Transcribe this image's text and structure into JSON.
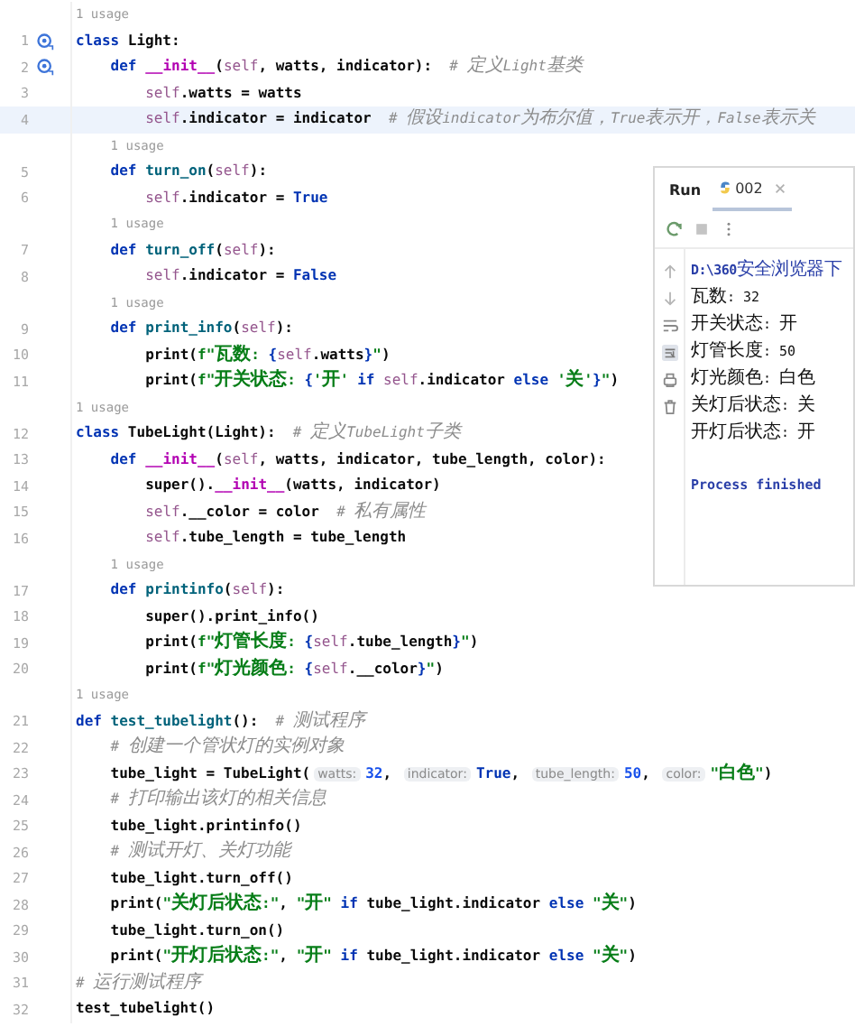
{
  "editor": {
    "lines": [
      {
        "usage": "1 usage",
        "number": "1",
        "highlighted": false,
        "gutter_mark": true,
        "tokens": [
          {
            "kind": "keyword",
            "text": "class"
          },
          {
            "kind": "plain",
            "text": " Light:"
          }
        ],
        "children": [
          {
            "number": "2",
            "highlighted": false,
            "gutter_mark": true,
            "tokens": [
              {
                "kind": "keyword",
                "text": "def"
              },
              {
                "kind": "magic",
                "text": " __init__"
              },
              {
                "kind": "plain",
                "text": "("
              },
              {
                "kind": "self",
                "text": "self"
              },
              {
                "kind": "plain",
                "text": ", watts, indicator):  "
              },
              {
                "kind": "comment",
                "text": "# 定义Light基类"
              }
            ],
            "children": [
              {
                "number": "3",
                "highlighted": false,
                "gutter_mark": false,
                "tokens": [
                  {
                    "kind": "self",
                    "text": "self"
                  },
                  {
                    "kind": "plain",
                    "text": ".watts = watts"
                  }
                ]
              },
              {
                "number": "4",
                "highlighted": true,
                "gutter_mark": false,
                "tokens": [
                  {
                    "kind": "self",
                    "text": "self"
                  },
                  {
                    "kind": "plain",
                    "text": ".indicator = indicator  "
                  },
                  {
                    "kind": "comment",
                    "text": "# 假设indicator为布尔值，True表示开，False表示关"
                  }
                ]
              }
            ]
          },
          {
            "usage": "1 usage",
            "number": "5",
            "highlighted": false,
            "gutter_mark": false,
            "tokens": [
              {
                "kind": "keyword",
                "text": "def"
              },
              {
                "kind": "name",
                "text": " turn_on"
              },
              {
                "kind": "plain",
                "text": "("
              },
              {
                "kind": "self",
                "text": "self"
              },
              {
                "kind": "plain",
                "text": "):"
              }
            ],
            "children": [
              {
                "number": "6",
                "highlighted": false,
                "gutter_mark": false,
                "tokens": [
                  {
                    "kind": "self",
                    "text": "self"
                  },
                  {
                    "kind": "plain",
                    "text": ".indicator = "
                  },
                  {
                    "kind": "keyword",
                    "text": "True"
                  }
                ]
              }
            ]
          },
          {
            "usage": "1 usage",
            "number": "7",
            "highlighted": false,
            "gutter_mark": false,
            "tokens": [
              {
                "kind": "keyword",
                "text": "def"
              },
              {
                "kind": "name",
                "text": " turn_off"
              },
              {
                "kind": "plain",
                "text": "("
              },
              {
                "kind": "self",
                "text": "self"
              },
              {
                "kind": "plain",
                "text": "):"
              }
            ],
            "children": [
              {
                "number": "8",
                "highlighted": false,
                "gutter_mark": false,
                "tokens": [
                  {
                    "kind": "self",
                    "text": "self"
                  },
                  {
                    "kind": "plain",
                    "text": ".indicator = "
                  },
                  {
                    "kind": "keyword",
                    "text": "False"
                  }
                ]
              }
            ]
          },
          {
            "usage": "1 usage",
            "number": "9",
            "highlighted": false,
            "gutter_mark": false,
            "tokens": [
              {
                "kind": "keyword",
                "text": "def"
              },
              {
                "kind": "name",
                "text": " print_info"
              },
              {
                "kind": "plain",
                "text": "("
              },
              {
                "kind": "self",
                "text": "self"
              },
              {
                "kind": "plain",
                "text": "):"
              }
            ],
            "children": [
              {
                "number": "10",
                "highlighted": false,
                "gutter_mark": false,
                "tokens": [
                  {
                    "kind": "plain",
                    "text": "print("
                  },
                  {
                    "kind": "string",
                    "text": "f\"瓦数: "
                  },
                  {
                    "kind": "keyword",
                    "text": "{"
                  },
                  {
                    "kind": "self",
                    "text": "self"
                  },
                  {
                    "kind": "plain",
                    "text": ".watts"
                  },
                  {
                    "kind": "keyword",
                    "text": "}"
                  },
                  {
                    "kind": "string",
                    "text": "\""
                  },
                  {
                    "kind": "plain",
                    "text": ")"
                  }
                ]
              },
              {
                "number": "11",
                "highlighted": false,
                "gutter_mark": false,
                "tokens": [
                  {
                    "kind": "plain",
                    "text": "print("
                  },
                  {
                    "kind": "string",
                    "text": "f\"开关状态: "
                  },
                  {
                    "kind": "keyword",
                    "text": "{"
                  },
                  {
                    "kind": "string",
                    "text": "'开' "
                  },
                  {
                    "kind": "keyword",
                    "text": "if "
                  },
                  {
                    "kind": "self",
                    "text": "self"
                  },
                  {
                    "kind": "plain",
                    "text": ".indicator "
                  },
                  {
                    "kind": "keyword",
                    "text": "else "
                  },
                  {
                    "kind": "string",
                    "text": "'关'"
                  },
                  {
                    "kind": "keyword",
                    "text": "}"
                  },
                  {
                    "kind": "string",
                    "text": "\""
                  },
                  {
                    "kind": "plain",
                    "text": ")"
                  }
                ]
              }
            ]
          }
        ]
      },
      {
        "usage": "1 usage",
        "number": "12",
        "highlighted": false,
        "gutter_mark": false,
        "tokens": [
          {
            "kind": "keyword",
            "text": "class"
          },
          {
            "kind": "plain",
            "text": " TubeLight(Light):  "
          },
          {
            "kind": "comment",
            "text": "# 定义TubeLight子类"
          }
        ],
        "children": [
          {
            "number": "13",
            "highlighted": false,
            "gutter_mark": false,
            "tokens": [
              {
                "kind": "keyword",
                "text": "def"
              },
              {
                "kind": "magic",
                "text": " __init__"
              },
              {
                "kind": "plain",
                "text": "("
              },
              {
                "kind": "self",
                "text": "self"
              },
              {
                "kind": "plain",
                "text": ", watts, indicator, tube_length, color):"
              }
            ],
            "children": [
              {
                "number": "14",
                "highlighted": false,
                "gutter_mark": false,
                "tokens": [
                  {
                    "kind": "plain",
                    "text": "super()."
                  },
                  {
                    "kind": "magic",
                    "text": "__init__"
                  },
                  {
                    "kind": "plain",
                    "text": "(watts, indicator)"
                  }
                ]
              },
              {
                "number": "15",
                "highlighted": false,
                "gutter_mark": false,
                "tokens": [
                  {
                    "kind": "self",
                    "text": "self"
                  },
                  {
                    "kind": "plain",
                    "text": ".__color = color  "
                  },
                  {
                    "kind": "comment",
                    "text": "# 私有属性"
                  }
                ]
              },
              {
                "number": "16",
                "highlighted": false,
                "gutter_mark": false,
                "tokens": [
                  {
                    "kind": "self",
                    "text": "self"
                  },
                  {
                    "kind": "plain",
                    "text": ".tube_length = tube_length"
                  }
                ]
              }
            ]
          },
          {
            "usage": "1 usage",
            "number": "17",
            "highlighted": false,
            "gutter_mark": false,
            "tokens": [
              {
                "kind": "keyword",
                "text": "def"
              },
              {
                "kind": "name",
                "text": " printinfo"
              },
              {
                "kind": "plain",
                "text": "("
              },
              {
                "kind": "self",
                "text": "self"
              },
              {
                "kind": "plain",
                "text": "):"
              }
            ],
            "children": [
              {
                "number": "18",
                "highlighted": false,
                "gutter_mark": false,
                "tokens": [
                  {
                    "kind": "plain",
                    "text": "super().print_info()"
                  }
                ]
              },
              {
                "number": "19",
                "highlighted": false,
                "gutter_mark": false,
                "tokens": [
                  {
                    "kind": "plain",
                    "text": "print("
                  },
                  {
                    "kind": "string",
                    "text": "f\"灯管长度: "
                  },
                  {
                    "kind": "keyword",
                    "text": "{"
                  },
                  {
                    "kind": "self",
                    "text": "self"
                  },
                  {
                    "kind": "plain",
                    "text": ".tube_length"
                  },
                  {
                    "kind": "keyword",
                    "text": "}"
                  },
                  {
                    "kind": "string",
                    "text": "\""
                  },
                  {
                    "kind": "plain",
                    "text": ")"
                  }
                ]
              },
              {
                "number": "20",
                "highlighted": false,
                "gutter_mark": false,
                "tokens": [
                  {
                    "kind": "plain",
                    "text": "print("
                  },
                  {
                    "kind": "string",
                    "text": "f\"灯光颜色: "
                  },
                  {
                    "kind": "keyword",
                    "text": "{"
                  },
                  {
                    "kind": "self",
                    "text": "self"
                  },
                  {
                    "kind": "plain",
                    "text": ".__color"
                  },
                  {
                    "kind": "keyword",
                    "text": "}"
                  },
                  {
                    "kind": "string",
                    "text": "\""
                  },
                  {
                    "kind": "plain",
                    "text": ")"
                  }
                ]
              }
            ]
          }
        ]
      },
      {
        "usage": "1 usage",
        "number": "21",
        "highlighted": false,
        "gutter_mark": false,
        "tokens": [
          {
            "kind": "keyword",
            "text": "def"
          },
          {
            "kind": "name",
            "text": " test_tubelight"
          },
          {
            "kind": "plain",
            "text": "():  "
          },
          {
            "kind": "comment",
            "text": "# 测试程序"
          }
        ],
        "children": [
          {
            "number": "22",
            "highlighted": false,
            "gutter_mark": false,
            "tokens": [
              {
                "kind": "comment",
                "text": "# 创建一个管状灯的实例对象"
              }
            ]
          },
          {
            "number": "23",
            "highlighted": false,
            "gutter_mark": false,
            "tokens": [
              {
                "kind": "plain",
                "text": "tube_light = TubeLight("
              },
              {
                "kind": "hint",
                "text": "watts:"
              },
              {
                "kind": "number",
                "text": "32"
              },
              {
                "kind": "plain",
                "text": ", "
              },
              {
                "kind": "hint",
                "text": "indicator:"
              },
              {
                "kind": "keyword",
                "text": "True"
              },
              {
                "kind": "plain",
                "text": ", "
              },
              {
                "kind": "hint",
                "text": "tube_length:"
              },
              {
                "kind": "number",
                "text": "50"
              },
              {
                "kind": "plain",
                "text": ", "
              },
              {
                "kind": "hint",
                "text": "color:"
              },
              {
                "kind": "string",
                "text": "\"白色\""
              },
              {
                "kind": "plain",
                "text": ")"
              }
            ]
          },
          {
            "number": "24",
            "highlighted": false,
            "gutter_mark": false,
            "tokens": [
              {
                "kind": "comment",
                "text": "# 打印输出该灯的相关信息"
              }
            ]
          },
          {
            "number": "25",
            "highlighted": false,
            "gutter_mark": false,
            "tokens": [
              {
                "kind": "plain",
                "text": "tube_light.printinfo()"
              }
            ]
          },
          {
            "number": "26",
            "highlighted": false,
            "gutter_mark": false,
            "tokens": [
              {
                "kind": "comment",
                "text": "# 测试开灯、关灯功能"
              }
            ]
          },
          {
            "number": "27",
            "highlighted": false,
            "gutter_mark": false,
            "tokens": [
              {
                "kind": "plain",
                "text": "tube_light.turn_off()"
              }
            ]
          },
          {
            "number": "28",
            "highlighted": false,
            "gutter_mark": false,
            "tokens": [
              {
                "kind": "plain",
                "text": "print("
              },
              {
                "kind": "string",
                "text": "\"关灯后状态:\""
              },
              {
                "kind": "plain",
                "text": ", "
              },
              {
                "kind": "string",
                "text": "\"开\" "
              },
              {
                "kind": "keyword",
                "text": "if"
              },
              {
                "kind": "plain",
                "text": " tube_light.indicator "
              },
              {
                "kind": "keyword",
                "text": "else"
              },
              {
                "kind": "string",
                "text": " \"关\""
              },
              {
                "kind": "plain",
                "text": ")"
              }
            ]
          },
          {
            "number": "29",
            "highlighted": false,
            "gutter_mark": false,
            "tokens": [
              {
                "kind": "plain",
                "text": "tube_light.turn_on()"
              }
            ]
          },
          {
            "number": "30",
            "highlighted": false,
            "gutter_mark": false,
            "tokens": [
              {
                "kind": "plain",
                "text": "print("
              },
              {
                "kind": "string",
                "text": "\"开灯后状态:\""
              },
              {
                "kind": "plain",
                "text": ", "
              },
              {
                "kind": "string",
                "text": "\"开\" "
              },
              {
                "kind": "keyword",
                "text": "if"
              },
              {
                "kind": "plain",
                "text": " tube_light.indicator "
              },
              {
                "kind": "keyword",
                "text": "else"
              },
              {
                "kind": "string",
                "text": " \"关\""
              },
              {
                "kind": "plain",
                "text": ")"
              }
            ]
          }
        ]
      },
      {
        "number": "31",
        "highlighted": false,
        "gutter_mark": false,
        "tokens": [
          {
            "kind": "comment",
            "text": "# 运行测试程序"
          }
        ]
      },
      {
        "number": "32",
        "highlighted": false,
        "gutter_mark": false,
        "tokens": [
          {
            "kind": "plain",
            "text": "test_tubelight()"
          }
        ]
      }
    ]
  },
  "run_panel": {
    "tabs": [
      {
        "label": "Run",
        "kind": "title",
        "selected": false
      },
      {
        "label": "002",
        "kind": "config",
        "selected": true
      }
    ],
    "output": [
      {
        "kind": "path",
        "text": "D:\\360安全浏览器下"
      },
      {
        "kind": "text",
        "text": "瓦数: 32"
      },
      {
        "kind": "text",
        "text": "开关状态: 开"
      },
      {
        "kind": "text",
        "text": "灯管长度: 50"
      },
      {
        "kind": "text",
        "text": "灯光颜色: 白色"
      },
      {
        "kind": "text",
        "text": "关灯后状态: 关"
      },
      {
        "kind": "text",
        "text": "开灯后状态: 开"
      },
      {
        "kind": "status",
        "text": "Process finished"
      }
    ]
  }
}
